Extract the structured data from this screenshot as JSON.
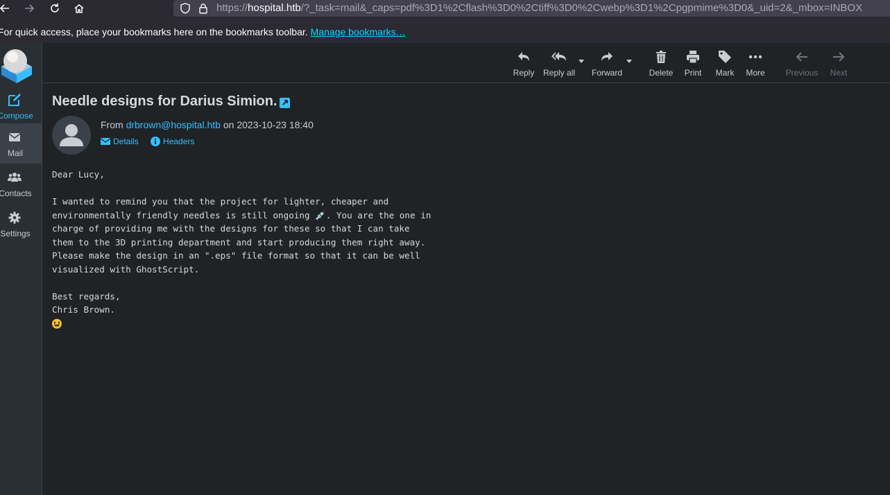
{
  "browser": {
    "url_prefix": "https://",
    "url_host": "hospital.htb",
    "url_rest": "/?_task=mail&_caps=pdf%3D1%2Cflash%3D0%2Ctiff%3D0%2Cwebp%3D1%2Cpgpmime%3D0&_uid=2&_mbox=INBOX",
    "bookmarks_text": "For quick access, place your bookmarks here on the bookmarks toolbar.",
    "bookmarks_link": "Manage bookmarks…"
  },
  "sidebar": {
    "items": [
      {
        "label": "Compose",
        "icon": "compose-icon"
      },
      {
        "label": "Mail",
        "icon": "envelope-icon"
      },
      {
        "label": "Contacts",
        "icon": "users-icon"
      },
      {
        "label": "Settings",
        "icon": "gear-icon"
      }
    ]
  },
  "toolbar": {
    "reply": "Reply",
    "reply_all": "Reply all",
    "forward": "Forward",
    "delete": "Delete",
    "print": "Print",
    "mark": "Mark",
    "more": "More",
    "previous": "Previous",
    "next": "Next"
  },
  "message": {
    "subject": "Needle designs for Darius Simion.",
    "from_prefix": "From",
    "from_email": "drbrown@hospital.htb",
    "date_prefix": "on",
    "date": "2023-10-23 18:40",
    "details_label": "Details",
    "headers_label": "Headers",
    "body": "Dear Lucy,\n\nI wanted to remind you that the project for lighter, cheaper and\nenvironmentally friendly needles is still ongoing 💉. You are the one in\ncharge of providing me with the designs for these so that I can take\nthem to the 3D printing department and start producing them right away.\nPlease make the design in an \".eps\" file format so that it can be well\nvisualized with GhostScript.\n\nBest regards,\nChris Brown."
  },
  "colors": {
    "accent": "#37beff",
    "background": "#1f2326",
    "sidebar": "#2a2f33"
  }
}
